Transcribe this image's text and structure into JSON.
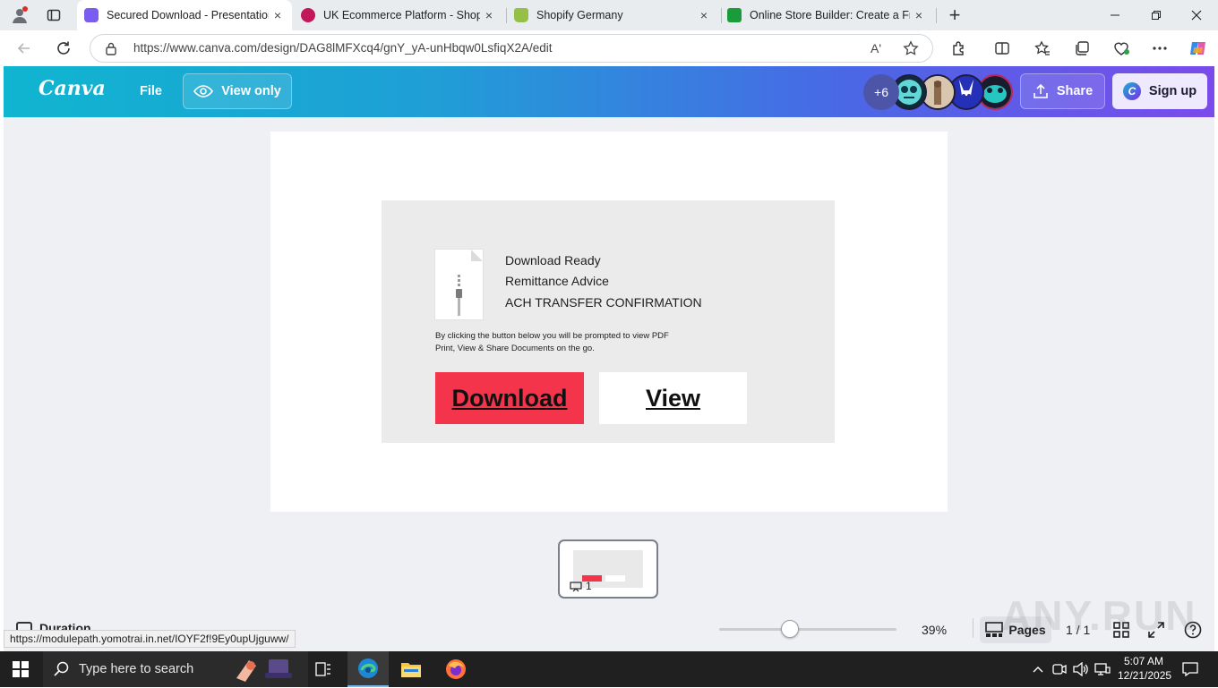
{
  "browser": {
    "tabs": [
      {
        "title": "Secured Download - Presentation",
        "favicon_color": "#7b5cf0",
        "active": true
      },
      {
        "title": "UK Ecommerce Platform - ShopWired",
        "favicon_color": "#c2185b",
        "active": false
      },
      {
        "title": "Shopify Germany",
        "favicon_color": "#95bf47",
        "active": false
      },
      {
        "title": "Online Store Builder: Create a Free Website",
        "favicon_color": "#1b9c3a",
        "active": false
      }
    ],
    "url": "https://www.canva.com/design/DAG8lMFXcq4/gnY_yA-unHbqw0LsfiqX2A/edit",
    "status_url": "https://modulepath.yomotrai.in.net/IOYF2f!9Ey0upUjguww/",
    "read_aloud_label": "Aʹ",
    "close_glyph": "×",
    "new_tab_glyph": "+"
  },
  "canva": {
    "logo": "Canva",
    "file_label": "File",
    "view_only_label": "View only",
    "collaborators_count": "+6",
    "share_label": "Share",
    "signup_label": "Sign up",
    "accent": "#7d2ae8"
  },
  "design": {
    "heading_lines": [
      "Download Ready",
      "Remittance Advice",
      "ACH TRANSFER CONFIRMATION"
    ],
    "note_line1": "By clicking the button below you will be prompted to view PDF",
    "note_line2": "Print, View & Share Documents on the go.",
    "download_label": "Download",
    "view_label": "View",
    "download_color": "#f4344a"
  },
  "footer": {
    "duration_label": "Duration",
    "zoom": "39%",
    "zoom_fraction": 0.39,
    "pages_label": "Pages",
    "page_indicator": "1 / 1",
    "thumbnail_number": "1",
    "watermark": "ANY.RUN"
  },
  "taskbar": {
    "search_placeholder": "Type here to search",
    "time": "5:07 AM",
    "date": "12/21/2025"
  }
}
